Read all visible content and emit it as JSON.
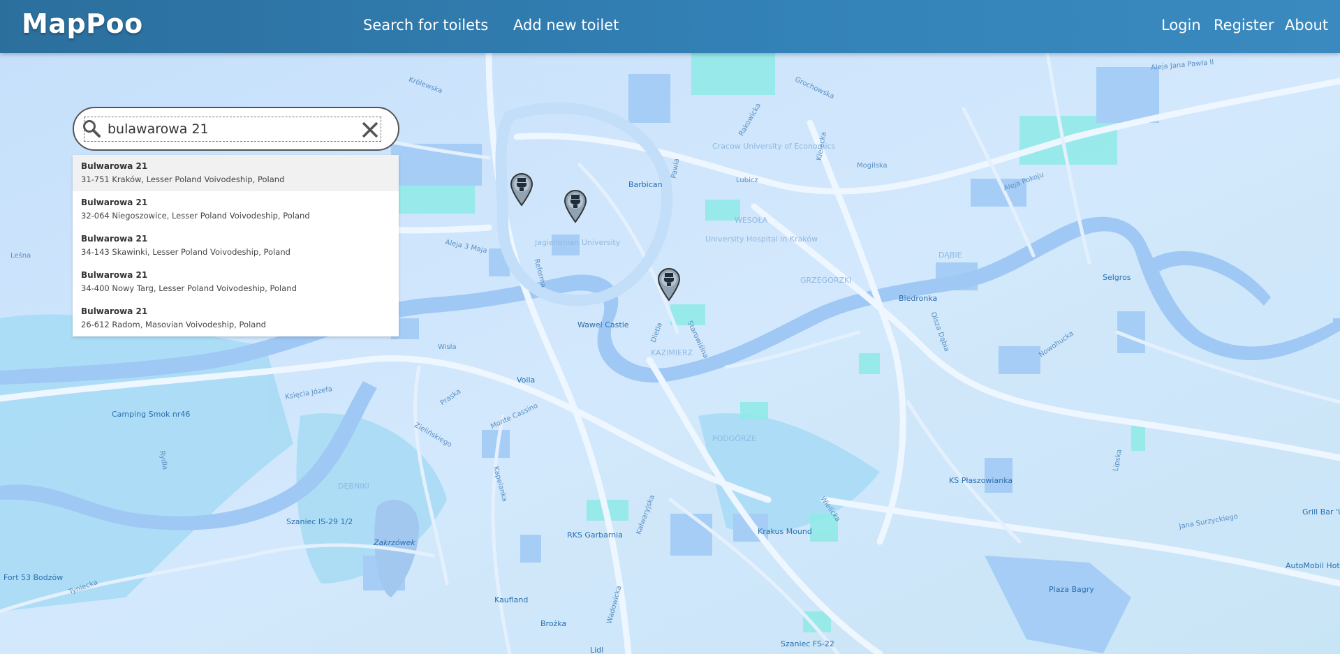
{
  "app": {
    "brand": "MapPoo",
    "nav_left": [
      "Search for toilets",
      "Add new toilet"
    ],
    "nav_right": [
      "Login",
      "Register",
      "About"
    ]
  },
  "search": {
    "value": "bulawarowa 21",
    "icon": "search-icon",
    "clear_icon": "close-icon"
  },
  "suggestions": [
    {
      "title": "Bulwarowa 21",
      "address": "31-751 Kraków, Lesser Poland Voivodeship, Poland"
    },
    {
      "title": "Bulwarowa 21",
      "address": "32-064 Niegoszowice, Lesser Poland Voivodeship, Poland"
    },
    {
      "title": "Bulwarowa 21",
      "address": "34-143 Skawinki, Lesser Poland Voivodeship, Poland"
    },
    {
      "title": "Bulwarowa 21",
      "address": "34-400 Nowy Targ, Lesser Poland Voivodeship, Poland"
    },
    {
      "title": "Bulwarowa 21",
      "address": "26-612 Radom, Masovian Voivodeship, Poland"
    }
  ],
  "map": {
    "labels": {
      "barbican": "Barbican",
      "wawel": "Wawel Castle",
      "biedronka": "Biedronka",
      "selgros": "Selgros",
      "plaszowianka": "KS Płaszowianka",
      "krakus": "Krakus Mound",
      "garbarnia": "RKS Garbarnia",
      "kaufland": "Kaufland",
      "plaza": "Plaza Bagry",
      "voila": "Voila",
      "camping": "Camping Smok nr46",
      "fort": "Fort 53 Bodzów",
      "szaniec": "Szaniec IS-29 1/2",
      "szaniec_fs": "Szaniec FS-22",
      "zakrzowek": "Zakrzówek",
      "grill": "Grill Bar 'U",
      "automobil": "AutoMobil Hote",
      "brozka": "Brożka",
      "lidl": "Lidl",
      "jagiellonian": "Jagiellonian University",
      "univ_hospital": "University Hospital in Kraków",
      "krakow_econ": "Cracow University of Economics",
      "debniki": "DĘBNIKI",
      "kazimierz": "KAZIMIERZ",
      "podgorze": "PODGÓRZE",
      "wesola": "WESOŁA",
      "grzegorzki": "GRZEGORZKI",
      "dabie": "DĄBIE"
    },
    "streets": {
      "krolewska": "Królewska",
      "lubicz": "Lubicz",
      "mogilska": "Mogilska",
      "aleja_pokoju": "Aleja Pokoju",
      "aleja_3_maja": "Aleja 3 Maja",
      "ksiecia_jozefa": "Księcia Józefa",
      "monte_cassino": "Monte Cassino",
      "zielinskiego": "Zielińskiego",
      "kapelanka": "Kapelanka",
      "kalwaryjska": "Kalwaryjska",
      "wielicka": "Wielicka",
      "nowohucka": "Nowohucka",
      "jana_surzyckiego": "Jana Surzyckiego",
      "tyniecka": "Tyniecka",
      "wisla": "Wisła",
      "starowislna": "Starowiślna",
      "dietla": "Dietla",
      "olsza_dabia": "Olsza Dąbia",
      "praska": "Praska",
      "rakowicka": "Rakowicka",
      "grochowska": "Grochowska",
      "jana_pawla": "Aleja Jana Pawła II",
      "wadowicka": "Wadowicka",
      "lesna": "Leśna",
      "pawia": "Pawia",
      "kielecka": "Kielecka",
      "reforma": "Reforma",
      "rydla": "Rydla",
      "lipska": "Lipska"
    },
    "colors": {
      "land": "#cfe4fb",
      "water": "#9cc7f5",
      "parks": "#a8d8f7",
      "green": "#8ee5e8",
      "roads": "#f0f7ff",
      "buildings": "#a6cdf5"
    }
  }
}
